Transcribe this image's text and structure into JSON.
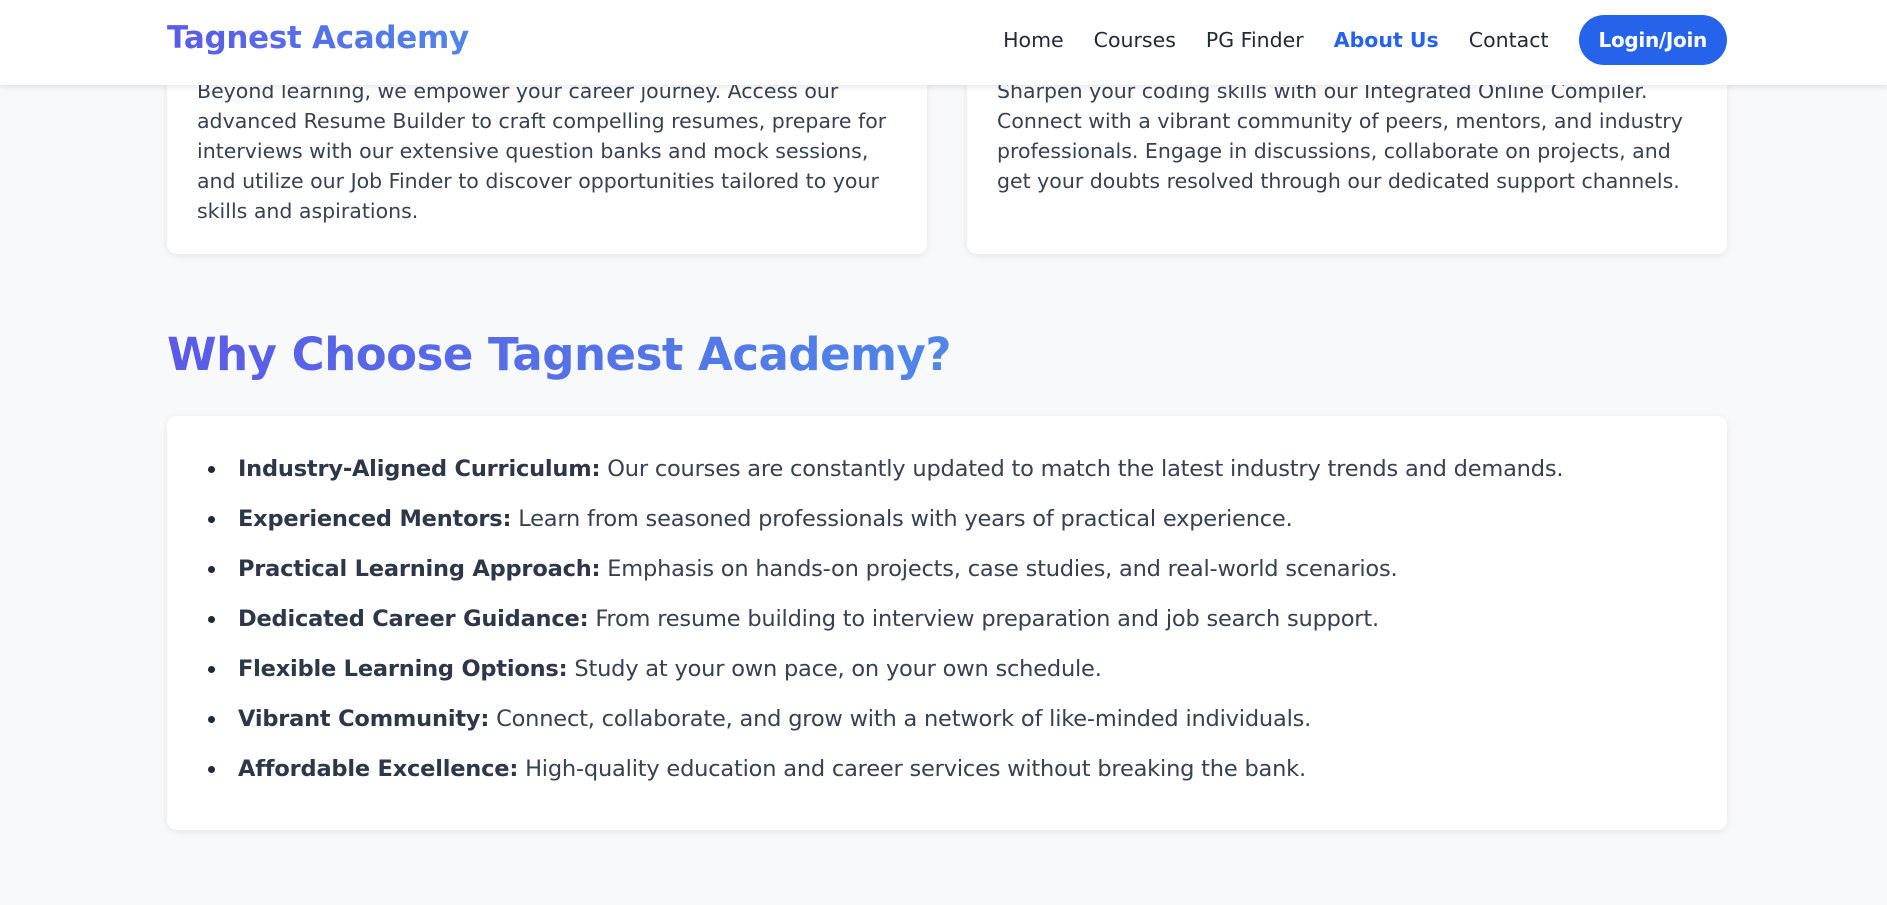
{
  "header": {
    "brand": "Tagnest Academy",
    "nav": [
      "Home",
      "Courses",
      "PG Finder",
      "About Us",
      "Contact"
    ],
    "active_nav": "About Us",
    "login_label": "Login/Join"
  },
  "cards": {
    "left_text": "Beyond learning, we empower your career journey. Access our advanced Resume Builder to craft compelling resumes, prepare for interviews with our extensive question banks and mock sessions, and utilize our Job Finder to discover opportunities tailored to your skills and aspirations.",
    "right_text": "Sharpen your coding skills with our Integrated Online Compiler. Connect with a vibrant community of peers, mentors, and industry professionals. Engage in discussions, collaborate on projects, and get your doubts resolved through our dedicated support channels."
  },
  "why": {
    "title": "Why Choose Tagnest Academy?",
    "items": [
      {
        "label": "Industry-Aligned Curriculum:",
        "text": " Our courses are constantly updated to match the latest industry trends and demands."
      },
      {
        "label": "Experienced Mentors:",
        "text": " Learn from seasoned professionals with years of practical experience."
      },
      {
        "label": "Practical Learning Approach:",
        "text": " Emphasis on hands-on projects, case studies, and real-world scenarios."
      },
      {
        "label": "Dedicated Career Guidance:",
        "text": " From resume building to interview preparation and job search support."
      },
      {
        "label": "Flexible Learning Options:",
        "text": " Study at your own pace, on your own schedule."
      },
      {
        "label": "Vibrant Community:",
        "text": " Connect, collaborate, and grow with a network of like-minded individuals."
      },
      {
        "label": "Affordable Excellence:",
        "text": " High-quality education and career services without breaking the bank."
      }
    ]
  },
  "colors": {
    "accent": "#2563eb",
    "brand_gradient_start": "#5b5be6",
    "brand_gradient_end": "#4f86e8"
  }
}
